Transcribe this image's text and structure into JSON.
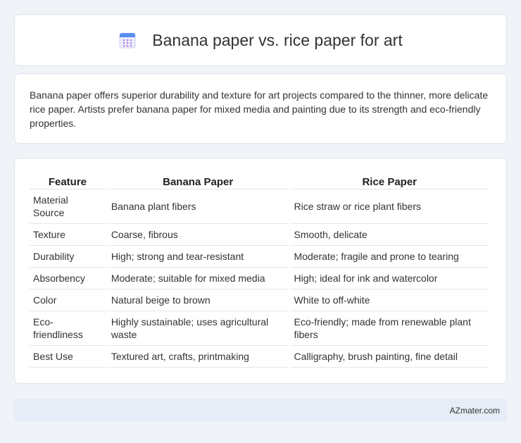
{
  "header": {
    "title": "Banana paper vs. rice paper for art",
    "icon": "calendar-icon"
  },
  "intro": {
    "text": "Banana paper offers superior durability and texture for art projects compared to the thinner, more delicate rice paper. Artists prefer banana paper for mixed media and painting due to its strength and eco-friendly properties."
  },
  "table": {
    "headers": [
      "Feature",
      "Banana Paper",
      "Rice Paper"
    ],
    "rows": [
      [
        "Material Source",
        "Banana plant fibers",
        "Rice straw or rice plant fibers"
      ],
      [
        "Texture",
        "Coarse, fibrous",
        "Smooth, delicate"
      ],
      [
        "Durability",
        "High; strong and tear-resistant",
        "Moderate; fragile and prone to tearing"
      ],
      [
        "Absorbency",
        "Moderate; suitable for mixed media",
        "High; ideal for ink and watercolor"
      ],
      [
        "Color",
        "Natural beige to brown",
        "White to off-white"
      ],
      [
        "Eco-friendliness",
        "Highly sustainable; uses agricultural waste",
        "Eco-friendly; made from renewable plant fibers"
      ],
      [
        "Best Use",
        "Textured art, crafts, printmaking",
        "Calligraphy, brush painting, fine detail"
      ]
    ]
  },
  "footer": {
    "text": "AZmater.com"
  },
  "colors": {
    "background": "#f0f3f8",
    "card": "#ffffff",
    "footer": "#e6edf6"
  }
}
